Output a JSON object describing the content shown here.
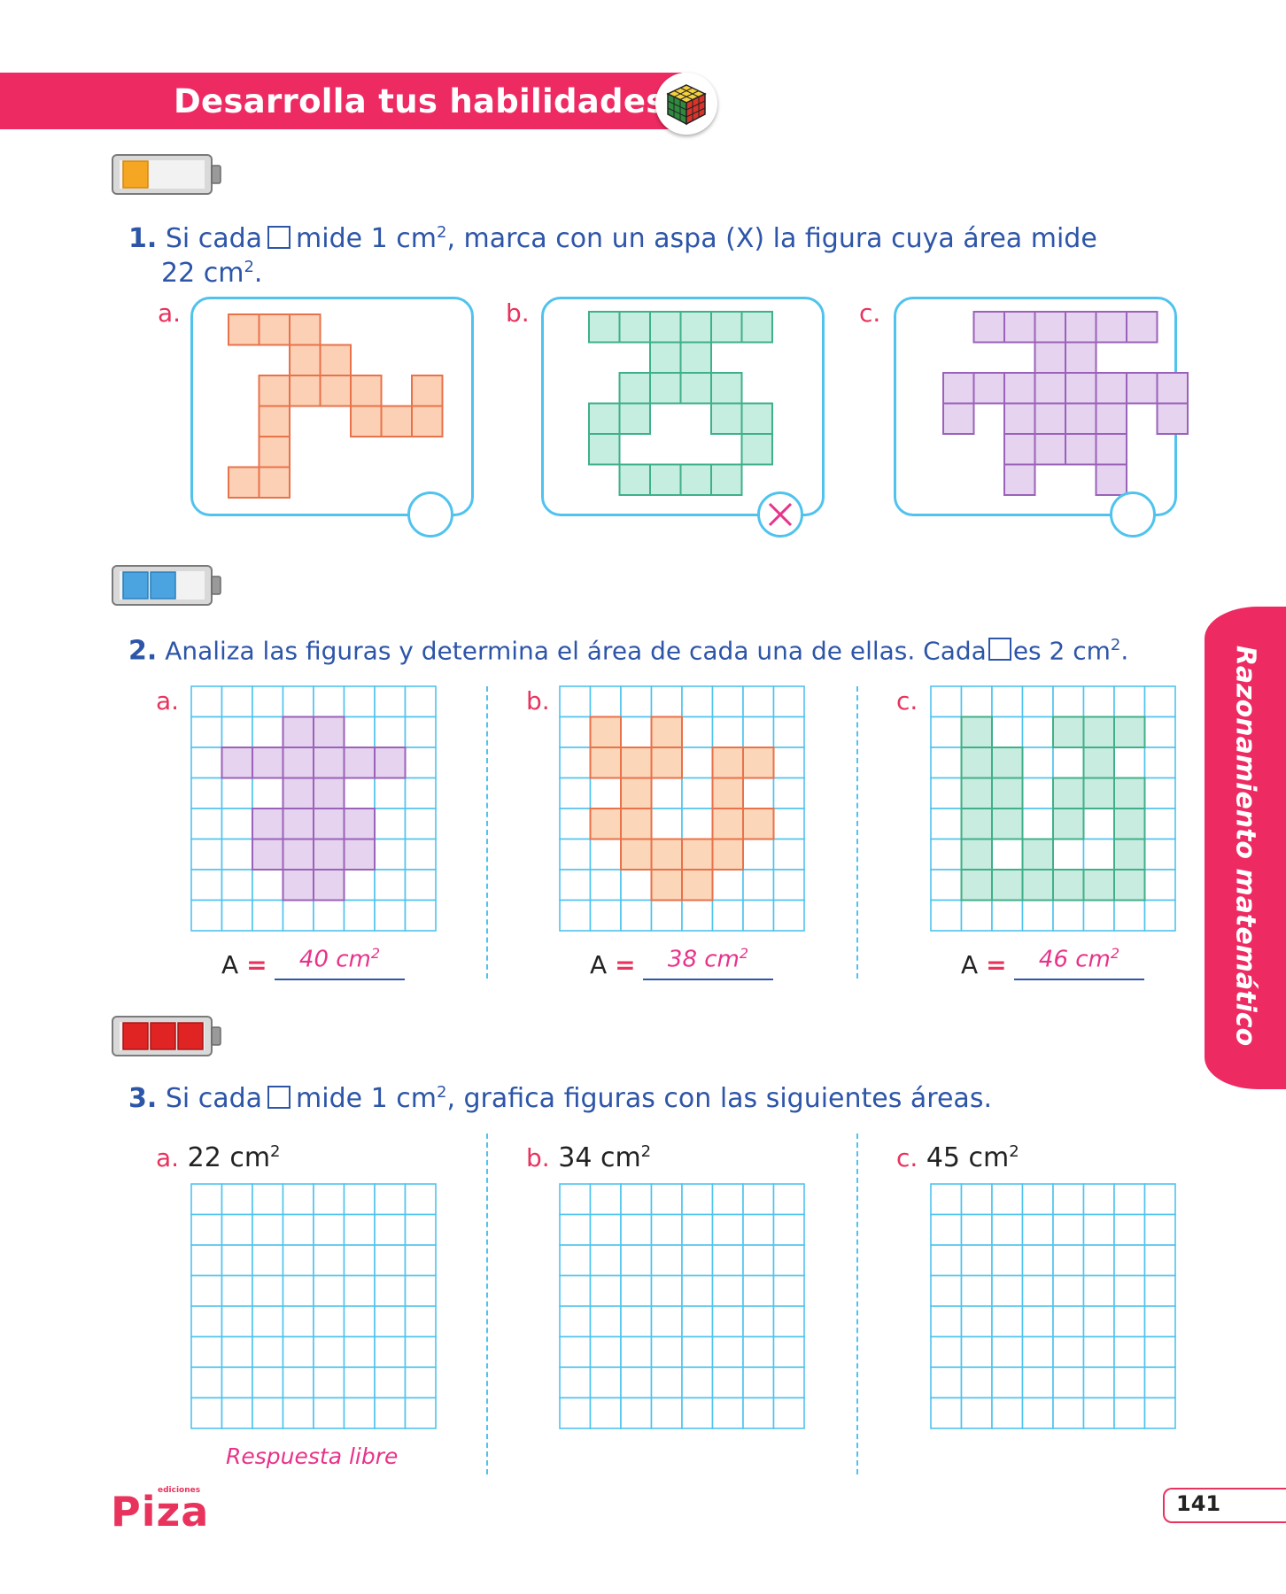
{
  "header": {
    "title": "Desarrolla tus habilidades"
  },
  "side_tab": {
    "label": "Razonamiento matemático"
  },
  "exercise1": {
    "number": "1.",
    "text_part1": "Si cada",
    "text_part2": "mide 1 cm",
    "text_part3": ", marca con un aspa (X) la figura cuya área mide",
    "text_line2": "22 cm",
    "text_line2_end": ".",
    "sup": "2",
    "options": [
      {
        "label": "a.",
        "color": "#f4a070",
        "marked": false
      },
      {
        "label": "b.",
        "color": "#5fcba8",
        "marked": true
      },
      {
        "label": "c.",
        "color": "#b98ed0",
        "marked": false
      }
    ]
  },
  "exercise2": {
    "number": "2.",
    "text_part1": "Analiza las figuras y determina el área de cada una de ellas. Cada",
    "text_part2": "es 2 cm",
    "text_end": ".",
    "sup": "2",
    "items": [
      {
        "label": "a.",
        "area_label": "A",
        "equals": "=",
        "answer": "40 cm",
        "answer_sup": "2"
      },
      {
        "label": "b.",
        "area_label": "A",
        "equals": "=",
        "answer": "38 cm",
        "answer_sup": "2"
      },
      {
        "label": "c.",
        "area_label": "A",
        "equals": "=",
        "answer": "46 cm",
        "answer_sup": "2"
      }
    ]
  },
  "exercise3": {
    "number": "3.",
    "text_part1": "Si cada",
    "text_part2": "mide 1 cm",
    "text_part3": ", grafica figuras con las siguientes áreas.",
    "sup": "2",
    "items": [
      {
        "label": "a.",
        "value": "22 cm",
        "sup": "2"
      },
      {
        "label": "b.",
        "value": "34 cm",
        "sup": "2"
      },
      {
        "label": "c.",
        "value": "45 cm",
        "sup": "2"
      }
    ],
    "free_answer": "Respuesta libre"
  },
  "footer": {
    "logo": "Piza",
    "logo_small": "ediciones",
    "page_number": "141"
  },
  "colors": {
    "accent": "#ee2a62",
    "grid": "#4fc3ee",
    "text_blue": "#2d55a8"
  }
}
